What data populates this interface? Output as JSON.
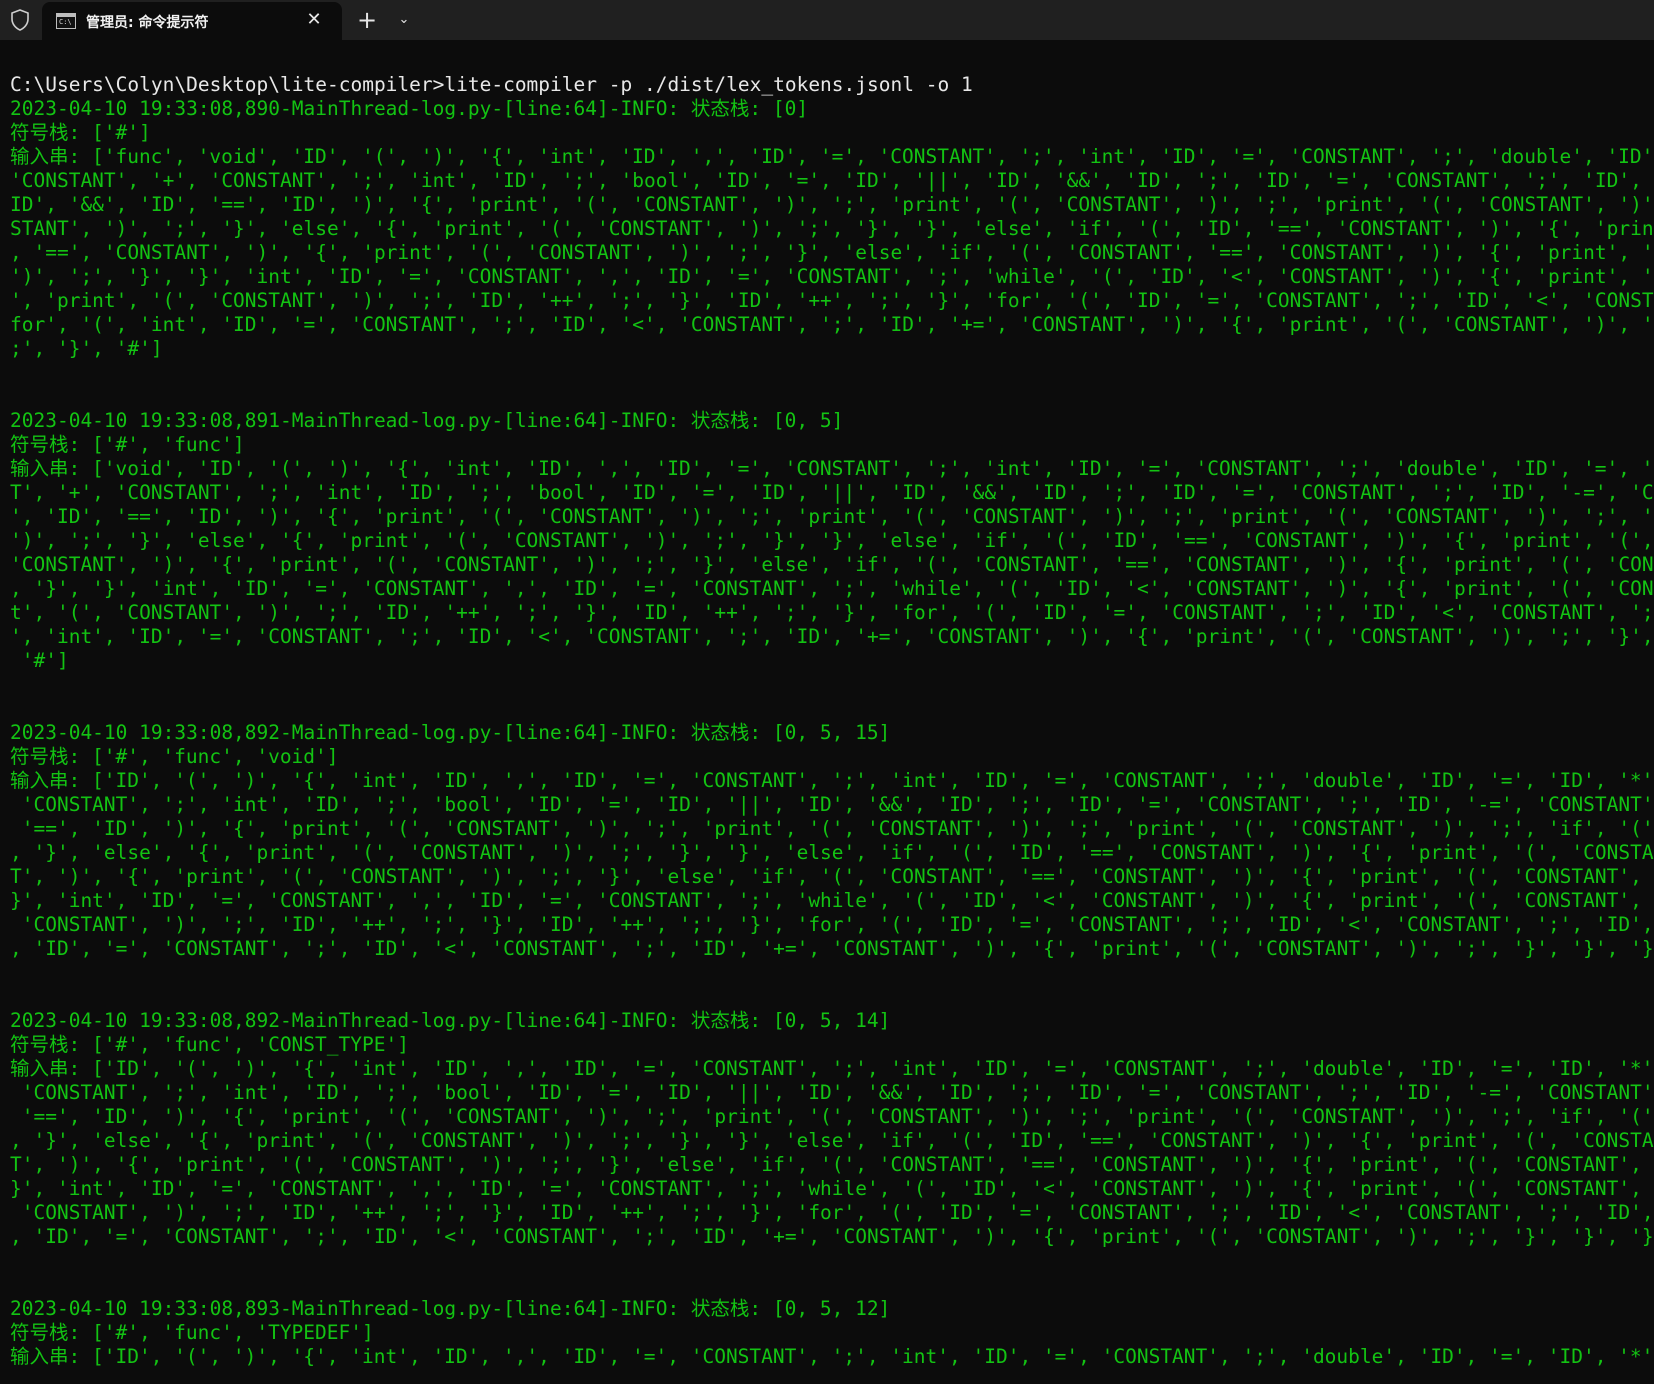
{
  "window": {
    "tab_title": "管理员: 命令提示符",
    "tab_icon": "cmd-icon",
    "new_tab_label": "+",
    "close_label": "✕",
    "dropdown_label": "⌄"
  },
  "colors": {
    "background": "#0c0c0c",
    "titlebar": "#202020",
    "text_green": "#13c313",
    "text_white": "#e8e8e8"
  },
  "console": {
    "command": "C:\\Users\\Colyn\\Desktop\\lite-compiler>lite-compiler -p ./dist/lex_tokens.jsonl -o 1",
    "blocks": [
      {
        "header": "2023-04-10 19:33:08,890-MainThread-log.py-[line:64]-INFO: 状态栈: [0]",
        "symbol": "符号栈: ['#']",
        "input": [
          "输入串: ['func', 'void', 'ID', '(', ')', '{', 'int', 'ID', ',', 'ID', '=', 'CONSTANT', ';', 'int', 'ID', '=', 'CONSTANT', ';', 'double', 'ID', '=', 'ID',",
          "'CONSTANT', '+', 'CONSTANT', ';', 'int', 'ID', ';', 'bool', 'ID', '=', 'ID', '||', 'ID', '&&', 'ID', ';', 'ID', '=', 'CONSTANT', ';', 'ID', '-=', 'CON",
          "ID', '&&', 'ID', '==', 'ID', ')', '{', 'print', '(', 'CONSTANT', ')', ';', 'print', '(', 'CONSTANT', ')', ';', 'print', '(', 'CONSTANT', ')', ';', 'pr",
          "STANT', ')', ';', '}', 'else', '{', 'print', '(', 'CONSTANT', ')', ';', '}', '}', 'else', 'if', '(', 'ID', '==', 'CONSTANT', ')', '{', 'print', '(', 'C",
          ", '==', 'CONSTANT', ')', '{', 'print', '(', 'CONSTANT', ')', ';', '}', 'else', 'if', '(', 'CONSTANT', '==', 'CONSTANT', ')', '{', 'print', '(', 'CONST",
          "')', ';', '}', '}', 'int', 'ID', '=', 'CONSTANT', ',', 'ID', '=', 'CONSTANT', ';', 'while', '(', 'ID', '<', 'CONSTANT', ')', '{', 'print', '(', 'CONSTA",
          "', 'print', '(', 'CONSTANT', ')', ';', 'ID', '++', ';', '}', 'ID', '++', ';', '}', 'for', '(', 'ID', '=', 'CONSTANT', ';', 'ID', '<', 'CONSTANT', ';', ",
          "for', '(', 'int', 'ID', '=', 'CONSTANT', ';', 'ID', '<', 'CONSTANT', ';', 'ID', '+=', 'CONSTANT', ')', '{', 'print', '(', 'CONSTANT', ')', ';', '}', '",
          ";', '}', '#']"
        ]
      },
      {
        "header": "2023-04-10 19:33:08,891-MainThread-log.py-[line:64]-INFO: 状态栈: [0, 5]",
        "symbol": "符号栈: ['#', 'func']",
        "input": [
          "输入串: ['void', 'ID', '(', ')', '{', 'int', 'ID', ',', 'ID', '=', 'CONSTANT', ';', 'int', 'ID', '=', 'CONSTANT', ';', 'double', 'ID', '=', 'ID', '*', 'C",
          "T', '+', 'CONSTANT', ';', 'int', 'ID', ';', 'bool', 'ID', '=', 'ID', '||', 'ID', '&&', 'ID', ';', 'ID', '=', 'CONSTANT', ';', 'ID', '-=', 'CONSTANT', '",
          "', 'ID', '==', 'ID', ')', '{', 'print', '(', 'CONSTANT', ')', ';', 'print', '(', 'CONSTANT', ')', ';', 'print', '(', 'CONSTANT', ')', ';', 'print', '(',",
          "')', ';', '}', 'else', '{', 'print', '(', 'CONSTANT', ')', ';', '}', '}', 'else', 'if', '(', 'ID', '==', 'CONSTANT', ')', '{', 'print', '(', 'CONSTANT'",
          "'CONSTANT', ')', '{', 'print', '(', 'CONSTANT', ')', ';', '}', 'else', 'if', '(', 'CONSTANT', '==', 'CONSTANT', ')', '{', 'print', '(', 'CONSTANT', ')',",
          ", '}', '}', 'int', 'ID', '=', 'CONSTANT', ',', 'ID', '=', 'CONSTANT', ';', 'while', '(', 'ID', '<', 'CONSTANT', ')', '{', 'print', '(', 'CONSTANT', ')',",
          "t', '(', 'CONSTANT', ')', ';', 'ID', '++', ';', '}', 'ID', '++', ';', '}', 'for', '(', 'ID', '=', 'CONSTANT', ';', 'ID', '<', 'CONSTANT', ';', 'ID', '++",
          "', 'int', 'ID', '=', 'CONSTANT', ';', 'ID', '<', 'CONSTANT', ';', 'ID', '+=', 'CONSTANT', ')', '{', 'print', '(', 'CONSTANT', ')', ';', '}', '}', '}',",
          " '#']"
        ]
      },
      {
        "header": "2023-04-10 19:33:08,892-MainThread-log.py-[line:64]-INFO: 状态栈: [0, 5, 15]",
        "symbol": "符号栈: ['#', 'func', 'void']",
        "input": [
          "输入串: ['ID', '(', ')', '{', 'int', 'ID', ',', 'ID', '=', 'CONSTANT', ';', 'int', 'ID', '=', 'CONSTANT', ';', 'double', 'ID', '=', 'ID', '*', 'CONSTANT',",
          " 'CONSTANT', ';', 'int', 'ID', ';', 'bool', 'ID', '=', 'ID', '||', 'ID', '&&', 'ID', ';', 'ID', '=', 'CONSTANT', ';', 'ID', '-=', 'CONSTANT', ';', 'if',",
          " '==', 'ID', ')', '{', 'print', '(', 'CONSTANT', ')', ';', 'print', '(', 'CONSTANT', ')', ';', 'print', '(', 'CONSTANT', ')', ';', 'if', '(', 'ID', '==',",
          ", '}', 'else', '{', 'print', '(', 'CONSTANT', ')', ';', '}', '}', 'else', 'if', '(', 'ID', '==', 'CONSTANT', ')', '{', 'print', '(', 'CONSTANT', ')', ';",
          "T', ')', '{', 'print', '(', 'CONSTANT', ')', ';', '}', 'else', 'if', '(', 'CONSTANT', '==', 'CONSTANT', ')', '{', 'print', '(', 'CONSTANT', ')', ';', '}",
          "}', 'int', 'ID', '=', 'CONSTANT', ',', 'ID', '=', 'CONSTANT', ';', 'while', '(', 'ID', '<', 'CONSTANT', ')', '{', 'print', '(', 'CONSTANT', ')', ';', 'p",
          " 'CONSTANT', ')', ';', 'ID', '++', ';', '}', 'ID', '++', ';', '}', 'for', '(', 'ID', '=', 'CONSTANT', ';', 'ID', '<', 'CONSTANT', ';', 'ID', '++', ')', ",
          ", 'ID', '=', 'CONSTANT', ';', 'ID', '<', 'CONSTANT', ';', 'ID', '+=', 'CONSTANT', ')', '{', 'print', '(', 'CONSTANT', ')', ';', '}', '}', '}', '#']"
        ]
      },
      {
        "header": "2023-04-10 19:33:08,892-MainThread-log.py-[line:64]-INFO: 状态栈: [0, 5, 14]",
        "symbol": "符号栈: ['#', 'func', 'CONST_TYPE']",
        "input": [
          "输入串: ['ID', '(', ')', '{', 'int', 'ID', ',', 'ID', '=', 'CONSTANT', ';', 'int', 'ID', '=', 'CONSTANT', ';', 'double', 'ID', '=', 'ID', '*', 'CONSTANT',",
          " 'CONSTANT', ';', 'int', 'ID', ';', 'bool', 'ID', '=', 'ID', '||', 'ID', '&&', 'ID', ';', 'ID', '=', 'CONSTANT', ';', 'ID', '-=', 'CONSTANT', ';', 'if',",
          " '==', 'ID', ')', '{', 'print', '(', 'CONSTANT', ')', ';', 'print', '(', 'CONSTANT', ')', ';', 'print', '(', 'CONSTANT', ')', ';', 'if', '(', 'ID', '==',",
          ", '}', 'else', '{', 'print', '(', 'CONSTANT', ')', ';', '}', '}', 'else', 'if', '(', 'ID', '==', 'CONSTANT', ')', '{', 'print', '(', 'CONSTANT', ')', ';",
          "T', ')', '{', 'print', '(', 'CONSTANT', ')', ';', '}', 'else', 'if', '(', 'CONSTANT', '==', 'CONSTANT', ')', '{', 'print', '(', 'CONSTANT', ')', ';', '}",
          "}', 'int', 'ID', '=', 'CONSTANT', ',', 'ID', '=', 'CONSTANT', ';', 'while', '(', 'ID', '<', 'CONSTANT', ')', '{', 'print', '(', 'CONSTANT', ')', ';', 'p",
          " 'CONSTANT', ')', ';', 'ID', '++', ';', '}', 'ID', '++', ';', '}', 'for', '(', 'ID', '=', 'CONSTANT', ';', 'ID', '<', 'CONSTANT', ';', 'ID', '++', ')', ",
          ", 'ID', '=', 'CONSTANT', ';', 'ID', '<', 'CONSTANT', ';', 'ID', '+=', 'CONSTANT', ')', '{', 'print', '(', 'CONSTANT', ')', ';', '}', '}', '}', '#']"
        ]
      },
      {
        "header": "2023-04-10 19:33:08,893-MainThread-log.py-[line:64]-INFO: 状态栈: [0, 5, 12]",
        "symbol": "符号栈: ['#', 'func', 'TYPEDEF']",
        "input": [
          "输入串: ['ID', '(', ')', '{', 'int', 'ID', ',', 'ID', '=', 'CONSTANT', ';', 'int', 'ID', '=', 'CONSTANT', ';', 'double', 'ID', '=', 'ID', '*', 'CONSTANT',"
        ]
      }
    ]
  }
}
